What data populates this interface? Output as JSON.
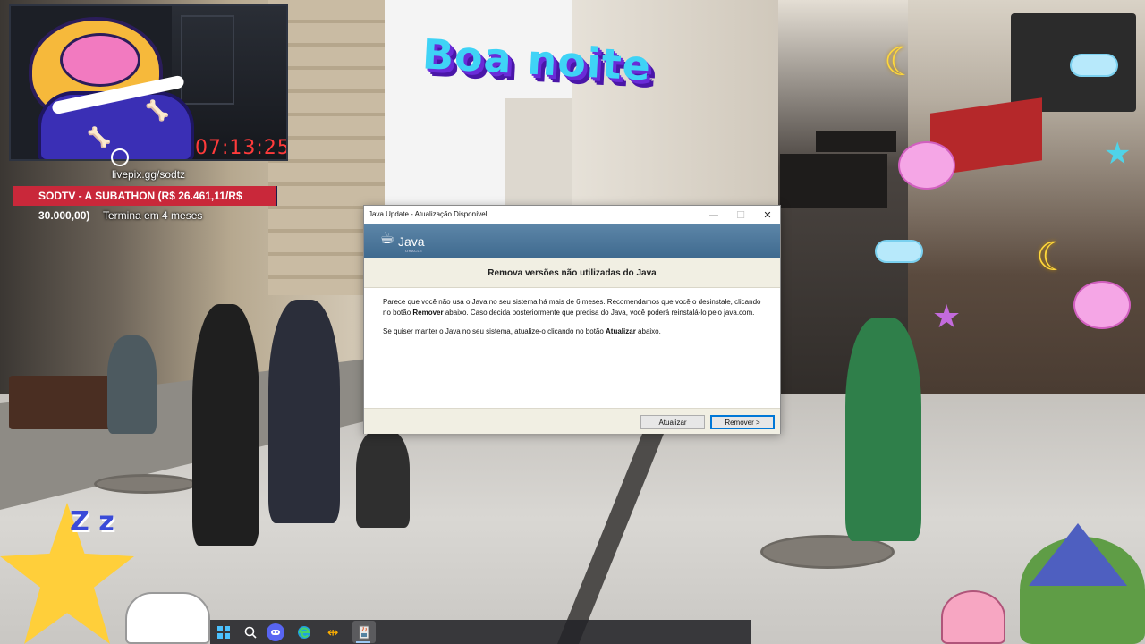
{
  "stream": {
    "timer": "07:13:25",
    "greeting": "Boa noite",
    "livepix": "livepix.gg/sodtz",
    "subathon": "SODTV - A SUBATHON (R$ 26.461,11/R$ 30.000,00)",
    "ends_in": "Termina em 4 meses"
  },
  "dialog": {
    "window_title": "Java Update - Atualização Disponível",
    "logo_word": "Java",
    "logo_sub": "ORACLE",
    "headline": "Remova versões não utilizadas do Java",
    "p1_a": "Parece que você não usa o Java no seu sistema há mais de 6 meses. Recomendamos que você o desinstale, clicando no botão ",
    "p1_bold": "Remover",
    "p1_b": " abaixo. Caso decida posteriormente que precisa do Java, você poderá reinstalá-lo pelo java.com.",
    "p2_a": "Se quiser manter o Java no seu sistema, atualize-o clicando no botão ",
    "p2_bold": "Atualizar",
    "p2_b": " abaixo.",
    "btn_update": "Atualizar",
    "btn_remove": "Remover >",
    "min_glyph": "—",
    "max_glyph": "☐",
    "close_glyph": "✕"
  },
  "taskbar": {
    "icons": [
      "windows-start-icon",
      "search-icon",
      "discord-icon",
      "edge-icon",
      "app-icon",
      "java-update-icon"
    ]
  },
  "colors": {
    "java_header": "#4f7ba0",
    "accent_focus": "#0078d7",
    "timer_red": "#ff3b3b",
    "subathon_bar": "#c9283a"
  }
}
